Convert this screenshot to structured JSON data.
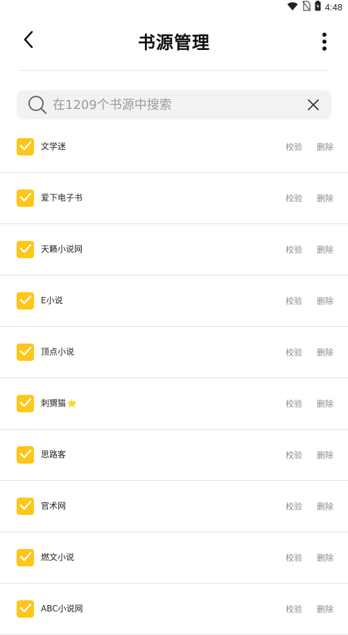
{
  "status_bar": {
    "time": "4:48",
    "icons": [
      "wifi-icon",
      "no-sim-icon",
      "battery-icon"
    ]
  },
  "header": {
    "title": "书源管理",
    "back_icon": "back-arrow-icon",
    "more_icon": "more-vertical-icon"
  },
  "search": {
    "placeholder": "在1209个书源中搜索",
    "value": "",
    "search_icon": "search-icon",
    "clear_icon": "close-icon"
  },
  "actions": {
    "verify_label": "校验",
    "delete_label": "删除"
  },
  "colors": {
    "accent": "#ffc61a",
    "star": "#f5b324",
    "action_text": "#8a8a8a"
  },
  "sources": [
    {
      "name": "文学迷",
      "checked": true,
      "star": false
    },
    {
      "name": "爱下电子书",
      "checked": true,
      "star": false
    },
    {
      "name": "天籁小说网",
      "checked": true,
      "star": false
    },
    {
      "name": "E小说",
      "checked": true,
      "star": false
    },
    {
      "name": "顶点小说",
      "checked": true,
      "star": false
    },
    {
      "name": "刺猬猫",
      "checked": true,
      "star": true
    },
    {
      "name": "思路客",
      "checked": true,
      "star": false
    },
    {
      "name": "官术网",
      "checked": true,
      "star": false
    },
    {
      "name": "燃文小说",
      "checked": true,
      "star": false
    },
    {
      "name": "ABC小说网",
      "checked": true,
      "star": false
    }
  ]
}
